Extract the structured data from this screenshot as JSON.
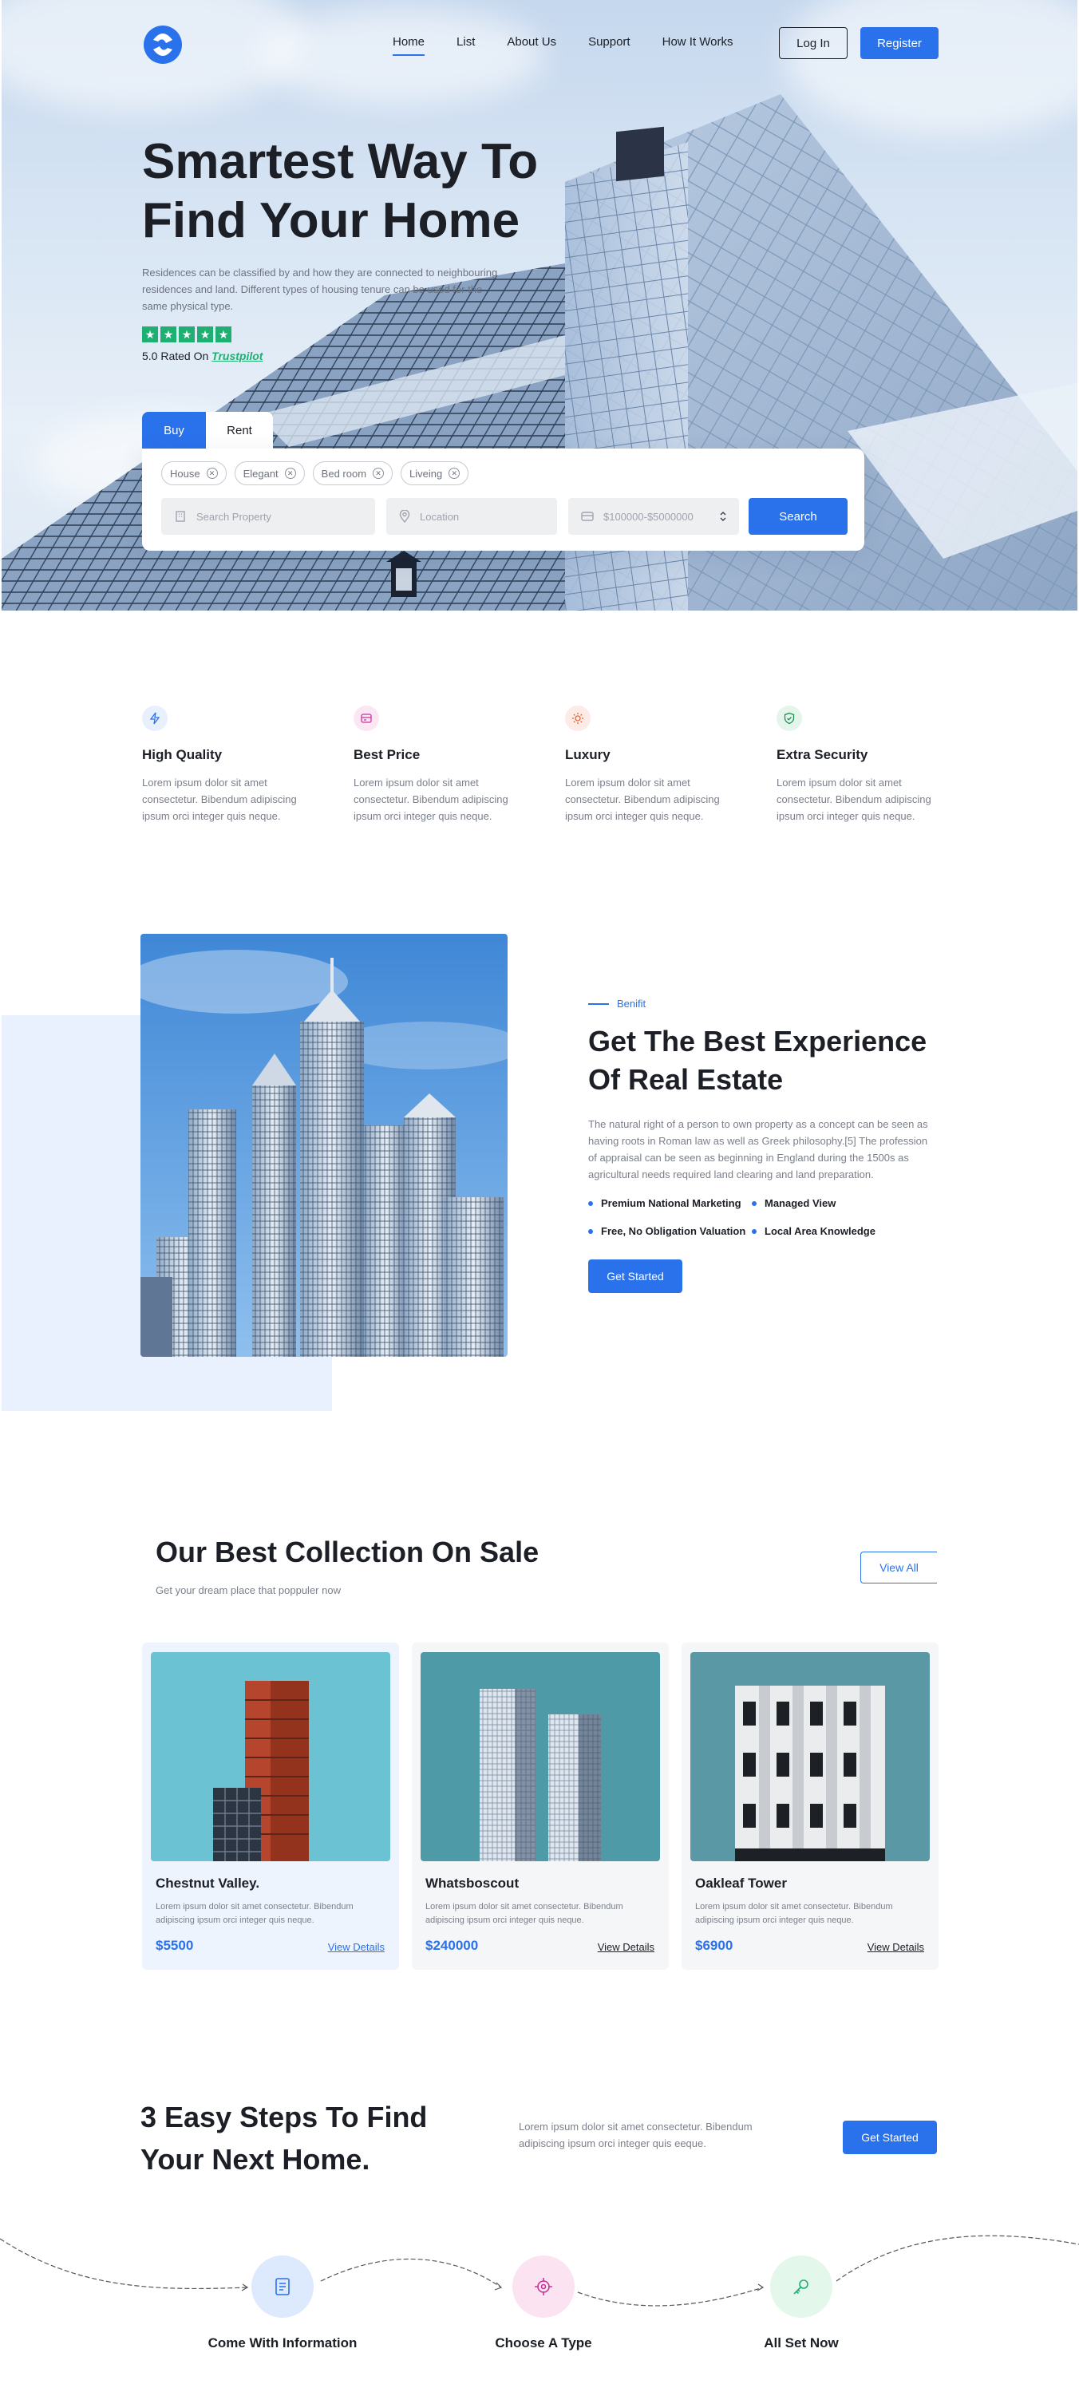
{
  "nav": {
    "items": [
      "Home",
      "List",
      "About Us",
      "Support",
      "How It Works"
    ],
    "login": "Log In",
    "register": "Register"
  },
  "hero": {
    "title": "Smartest Way To Find Your Home",
    "description": "Residences can be classified by and how they are connected to neighbouring residences and land. Different types of housing tenure can be used for the same physical type.",
    "rating_text": "5.0 Rated On",
    "rating_brand": "Trustpilot",
    "stars": 5
  },
  "search": {
    "tabs": [
      "Buy",
      "Rent"
    ],
    "active_tab": "Buy",
    "chips": [
      "House",
      "Elegant",
      "Bed room",
      "Liveing"
    ],
    "property_placeholder": "Search Property",
    "location_placeholder": "Location",
    "price_range": "$100000-$5000000",
    "button": "Search"
  },
  "features": [
    {
      "title": "High Quality",
      "text": "Lorem ipsum dolor sit amet consectetur. Bibendum adipiscing ipsum orci integer quis neque.",
      "icon": "lightning-icon",
      "color": "#2a71ec",
      "bg": "#e8f0fd"
    },
    {
      "title": "Best Price",
      "text": "Lorem ipsum dolor sit amet consectetur. Bibendum adipiscing ipsum orci integer quis neque.",
      "icon": "card-icon",
      "color": "#c6379a",
      "bg": "#fbe7f3"
    },
    {
      "title": "Luxury",
      "text": "Lorem ipsum dolor sit amet consectetur. Bibendum adipiscing ipsum orci integer quis neque.",
      "icon": "sparkle-icon",
      "color": "#e0663a",
      "bg": "#fdece6"
    },
    {
      "title": "Extra Security",
      "text": "Lorem ipsum dolor sit amet consectetur. Bibendum adipiscing ipsum orci integer quis neque.",
      "icon": "shield-icon",
      "color": "#1e8f4e",
      "bg": "#e6f5ec"
    }
  ],
  "experience": {
    "eyebrow": "Benifit",
    "title": "Get The Best Experience Of Real Estate",
    "description": "The natural right of a person to own property as a concept can be seen as having roots in Roman law as well as Greek philosophy.[5] The profession of appraisal can be seen as beginning in England during the 1500s as agricultural needs required land clearing and land preparation.",
    "bullets": [
      "Premium National Marketing",
      "Managed View",
      "Free, No Obligation Valuation",
      "Local Area Knowledge"
    ],
    "button": "Get Started"
  },
  "collection": {
    "title": "Our Best Collection On Sale",
    "subtitle": "Get your dream place that poppuler now",
    "view_all": "View All",
    "cards": [
      {
        "name": "Chestnut Valley.",
        "text": "Lorem ipsum dolor sit amet consectetur. Bibendum adipiscing ipsum orci integer quis neque.",
        "price": "$5500",
        "link": "View Details"
      },
      {
        "name": "Whatsboscout",
        "text": "Lorem ipsum dolor sit amet consectetur. Bibendum adipiscing ipsum orci integer quis neque.",
        "price": "$240000",
        "link": "View Details"
      },
      {
        "name": "Oakleaf Tower",
        "text": "Lorem ipsum dolor sit amet consectetur. Bibendum adipiscing ipsum orci integer quis neque.",
        "price": "$6900",
        "link": "View Details"
      }
    ]
  },
  "steps": {
    "title": "3 Easy Steps To Find Your Next Home.",
    "description": "Lorem ipsum dolor sit amet consectetur. Bibendum adipiscing ipsum orci integer quis eeque.",
    "button": "Get Started",
    "items": [
      {
        "label": "Come With Information",
        "icon": "form-icon",
        "color": "#2a71ec",
        "bg": "#dde9fc"
      },
      {
        "label": "Choose A Type",
        "icon": "target-icon",
        "color": "#c6379a",
        "bg": "#fbe3f1"
      },
      {
        "label": "All Set Now",
        "icon": "key-icon",
        "color": "#1eb073",
        "bg": "#e3f7ea"
      }
    ]
  }
}
